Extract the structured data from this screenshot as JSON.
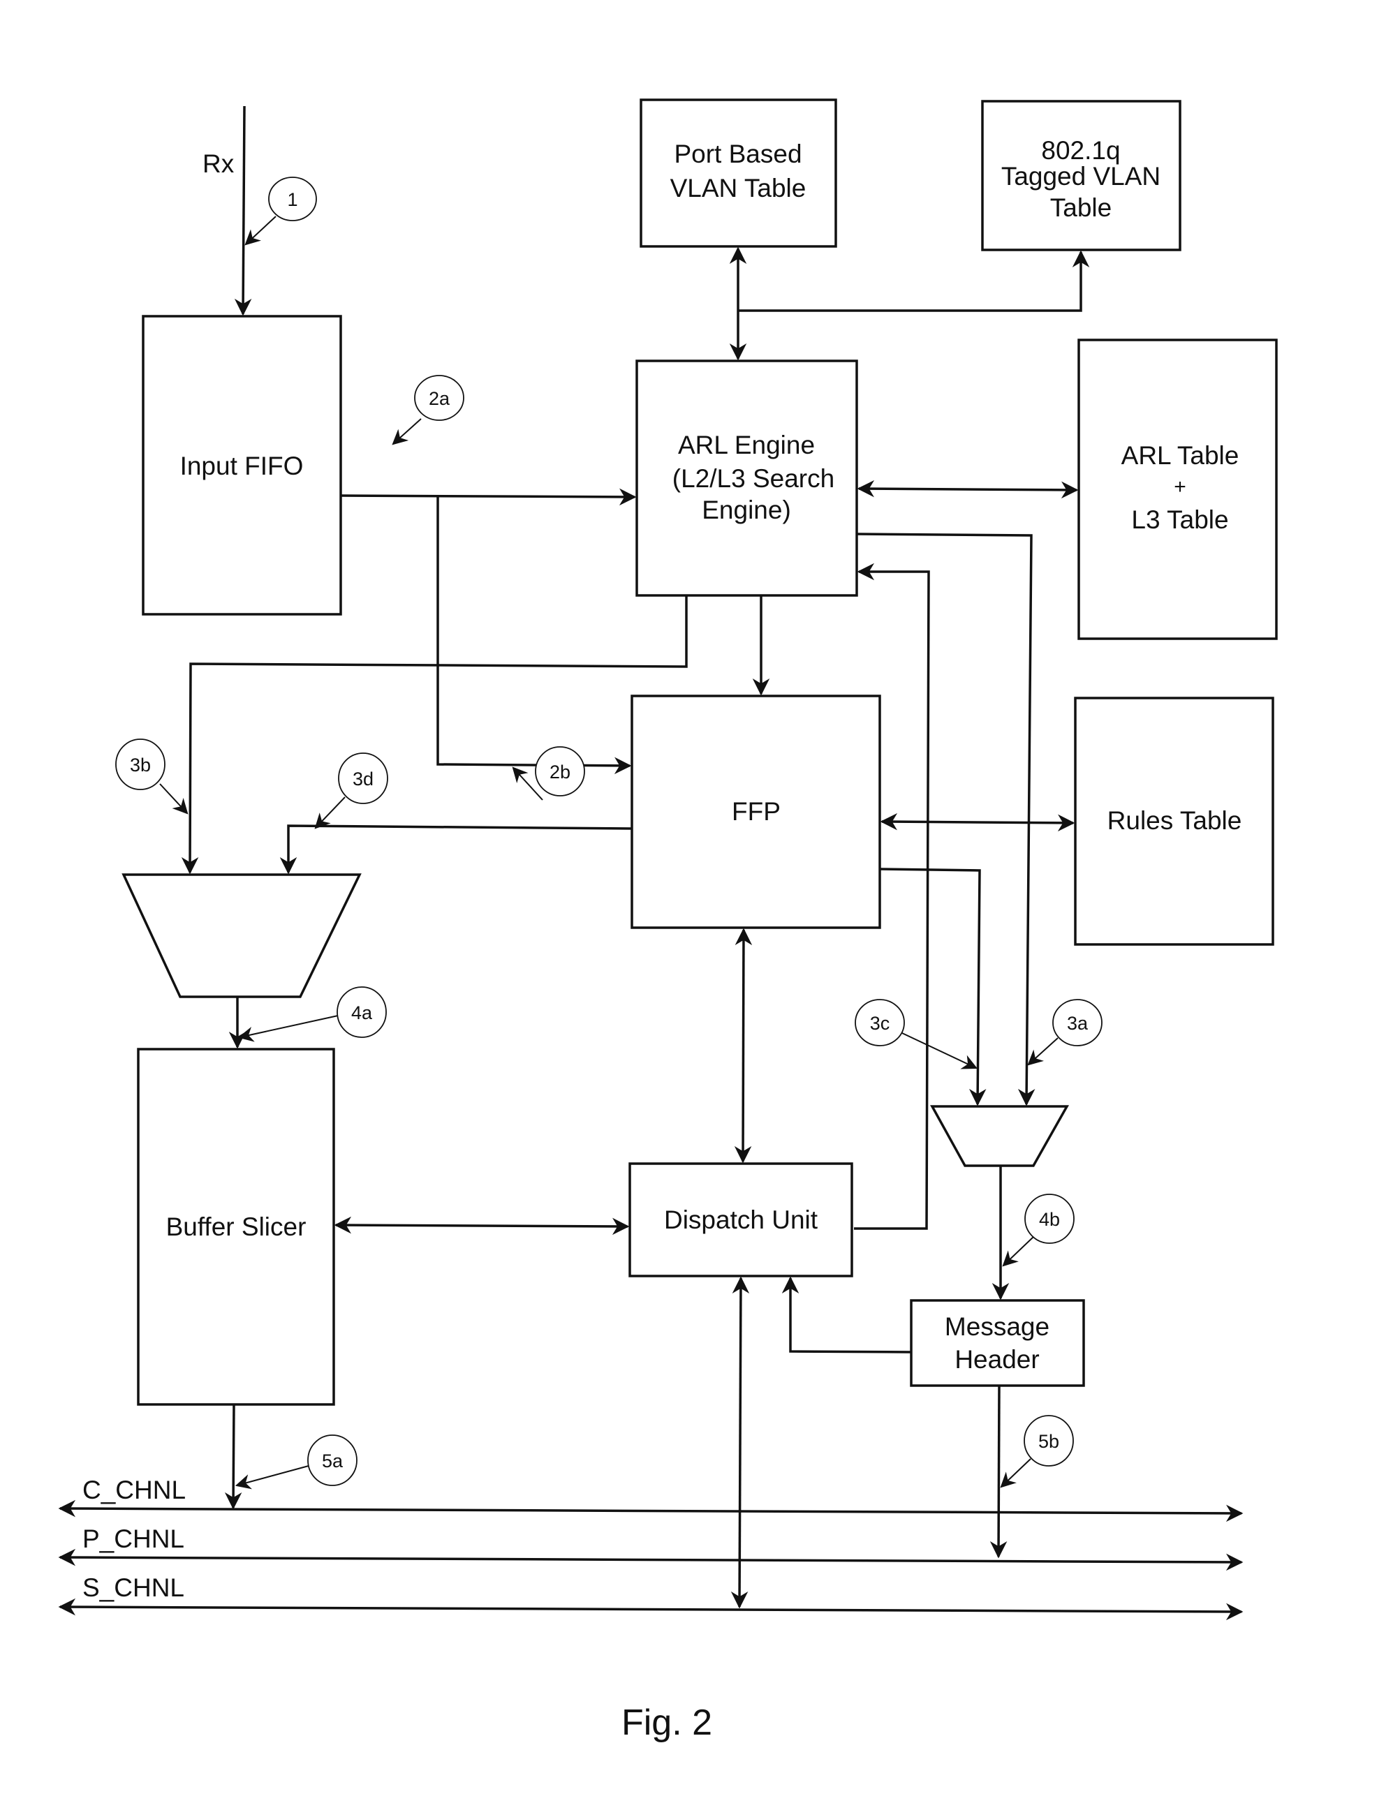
{
  "figure": {
    "caption": "Fig. 2",
    "input_signal_label": "Rx"
  },
  "blocks": {
    "input_fifo": [
      "Input FIFO"
    ],
    "port_vlan": [
      "Port Based",
      "VLAN Table"
    ],
    "tagged_vlan": [
      "802.1q",
      "Tagged VLAN",
      "Table"
    ],
    "arl_engine": [
      "ARL Engine",
      "(L2/L3 Search",
      "Engine)"
    ],
    "arl_table": [
      "ARL Table",
      "+",
      "L3 Table"
    ],
    "ffp": [
      "FFP"
    ],
    "rules_table": [
      "Rules Table"
    ],
    "buffer_slicer": [
      "Buffer Slicer"
    ],
    "dispatch_unit": [
      "Dispatch Unit"
    ],
    "message_header": [
      "Message",
      "Header"
    ]
  },
  "callouts": {
    "c1": "1",
    "c2a": "2a",
    "c2b": "2b",
    "c3a": "3a",
    "c3b": "3b",
    "c3c": "3c",
    "c3d": "3d",
    "c4a": "4a",
    "c4b": "4b",
    "c5a": "5a",
    "c5b": "5b"
  },
  "channels": {
    "c_chnl": "C_CHNL",
    "p_chnl": "P_CHNL",
    "s_chnl": "S_CHNL"
  }
}
